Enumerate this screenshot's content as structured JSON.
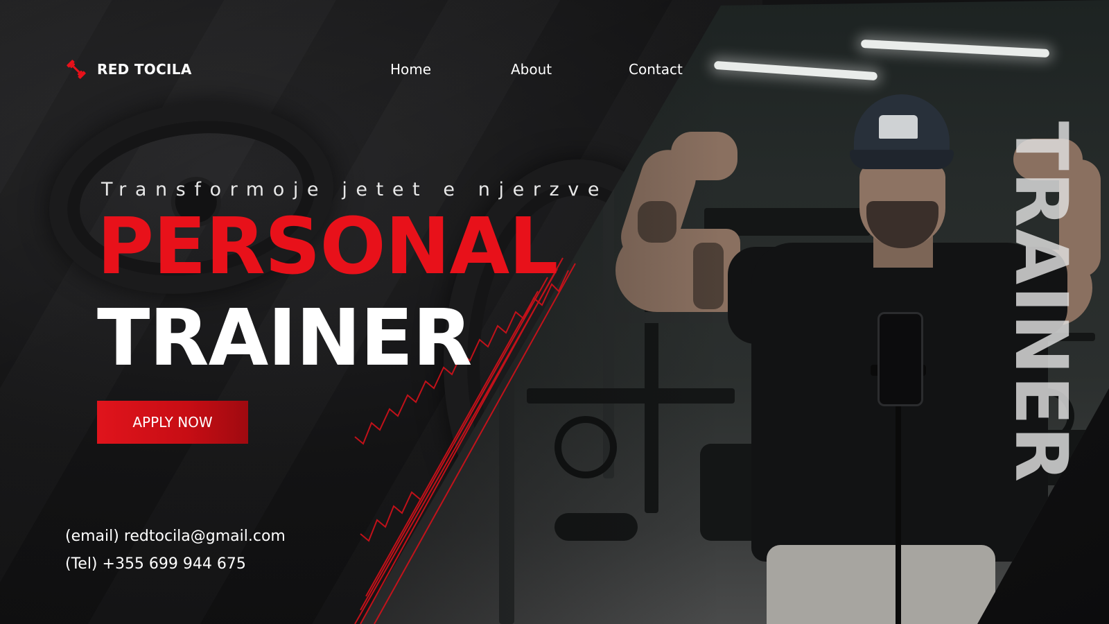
{
  "brand": {
    "name": "RED TOCILA",
    "logo_icon": "dumbbell-icon",
    "accent_color": "#e8111a"
  },
  "nav": {
    "items": [
      {
        "label": "Home"
      },
      {
        "label": "About"
      },
      {
        "label": "Contact"
      }
    ]
  },
  "hero": {
    "tagline": "Transformoje jetet e njerzve",
    "headline_line1": "PERSONAL",
    "headline_line2": "TRAINER",
    "cta_label": "APPLY NOW",
    "vertical_word": "TRAINER",
    "photo_description_icon": "trainer-photo"
  },
  "contact": {
    "email_line": "(email) redtocila@gmail.com",
    "phone_line": "(Tel) +355 699 944 675"
  }
}
